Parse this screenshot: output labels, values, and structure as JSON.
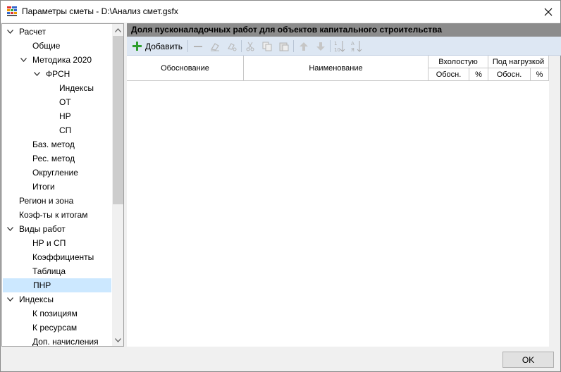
{
  "window": {
    "title": "Параметры сметы - D:\\Анализ смет.gsfx",
    "close_glyph": "✕"
  },
  "tree": {
    "items": [
      {
        "label": "Расчет",
        "expanded": true
      },
      {
        "label": "Общие"
      },
      {
        "label": "Методика 2020",
        "expanded": true
      },
      {
        "label": "ФРСН",
        "expanded": true
      },
      {
        "label": "Индексы"
      },
      {
        "label": "ОТ"
      },
      {
        "label": "НР"
      },
      {
        "label": "СП"
      },
      {
        "label": "Баз. метод"
      },
      {
        "label": "Рес. метод"
      },
      {
        "label": "Округление"
      },
      {
        "label": "Итоги"
      },
      {
        "label": "Регион и зона"
      },
      {
        "label": "Коэф-ты к итогам"
      },
      {
        "label": "Виды работ",
        "expanded": true
      },
      {
        "label": "НР и СП"
      },
      {
        "label": "Коэффициенты"
      },
      {
        "label": "Таблица"
      },
      {
        "label": "ПНР",
        "selected": true
      },
      {
        "label": "Индексы",
        "expanded": true
      },
      {
        "label": "К позициям"
      },
      {
        "label": "К ресурсам"
      },
      {
        "label": "Доп. начисления"
      }
    ]
  },
  "content": {
    "header": "Доля пусконаладочных работ для объектов капитального строительства",
    "toolbar": {
      "add_label": "Добавить"
    },
    "grid": {
      "col_basis": "Обоснование",
      "col_name": "Наименование",
      "col_idle": "Вхолостую",
      "col_load": "Под нагрузкой",
      "sub_basis": "Обосн.",
      "sub_pct": "%"
    }
  },
  "footer": {
    "ok_label": "OK"
  },
  "colors": {
    "header_bg": "#8c8c8c",
    "toolbar_bg": "#dde7f3",
    "selection": "#cce8ff",
    "add_icon": "#2e9e2e"
  }
}
